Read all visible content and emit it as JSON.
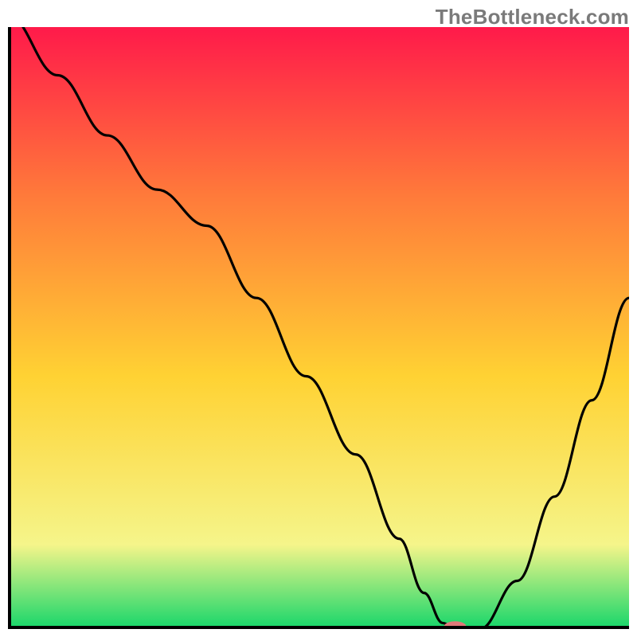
{
  "watermark": "TheBottleneck.com",
  "colors": {
    "gradient_top": "#ff1a4a",
    "gradient_mid_upper": "#ff7a3a",
    "gradient_mid": "#ffd233",
    "gradient_mid_lower": "#f5f58a",
    "gradient_bottom": "#15d66a",
    "line": "#000000",
    "marker": "#e07a7a",
    "axis": "#000000"
  },
  "chart_data": {
    "type": "line",
    "title": "",
    "xlabel": "",
    "ylabel": "",
    "xlim": [
      0,
      100
    ],
    "ylim": [
      0,
      100
    ],
    "annotations": [
      "TheBottleneck.com"
    ],
    "series": [
      {
        "name": "curve",
        "x": [
          0,
          8,
          16,
          24,
          32,
          40,
          48,
          56,
          63,
          67,
          70,
          72,
          76,
          82,
          88,
          94,
          100
        ],
        "y": [
          102,
          92,
          82,
          73,
          67,
          55,
          42,
          29,
          15,
          6,
          1,
          0,
          0,
          8,
          22,
          38,
          55
        ]
      }
    ],
    "marker": {
      "x": 72,
      "y": 0,
      "rx": 1.8,
      "ry": 0.9
    }
  }
}
